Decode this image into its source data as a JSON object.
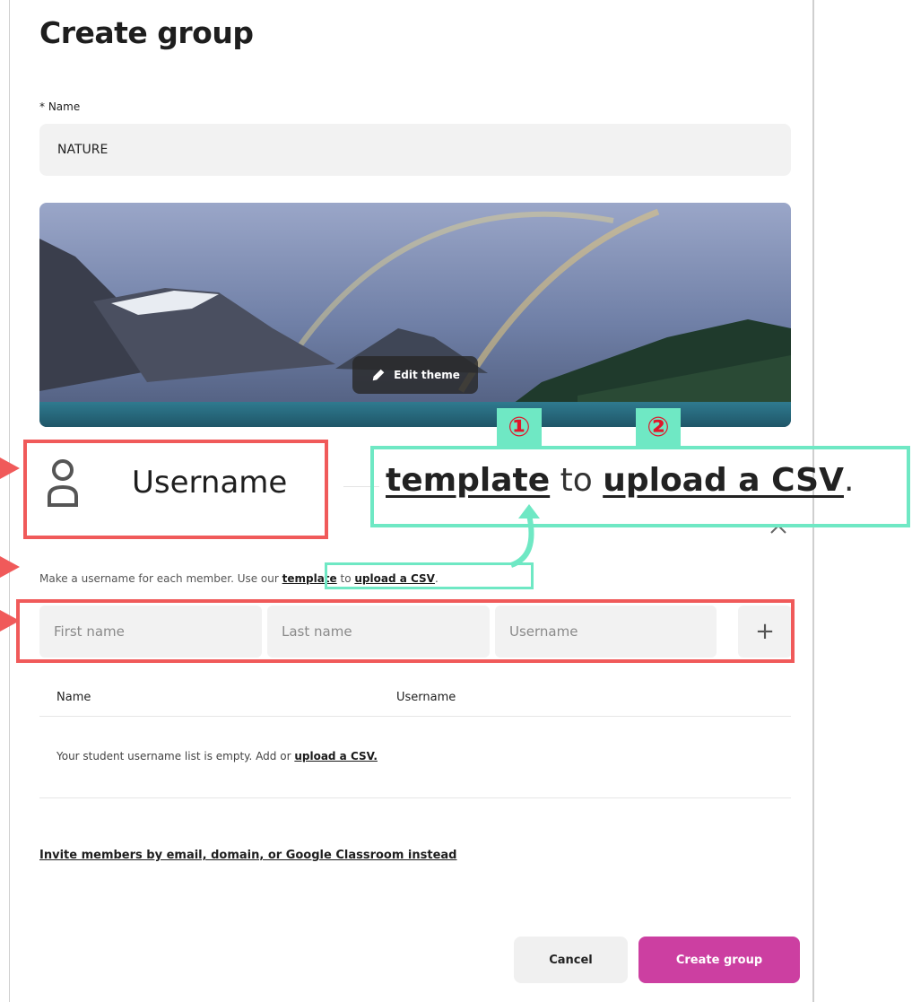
{
  "dialog": {
    "title": "Create group",
    "name_label": "* Name",
    "name_value": "NATURE",
    "edit_theme_label": "Edit theme"
  },
  "username_section": {
    "title": "Username",
    "help_prefix": "Make a username for each member. Use our ",
    "help_template_link": "template",
    "help_middle": " to ",
    "help_csv_link": "upload a CSV",
    "help_suffix": ".",
    "first_name_placeholder": "First name",
    "last_name_placeholder": "Last name",
    "username_placeholder": "Username",
    "add_label": "+"
  },
  "table": {
    "columns": [
      "Name",
      "Username"
    ],
    "empty_prefix": "Your student username list is empty. Add or ",
    "empty_link": "upload a CSV."
  },
  "invite_link": "Invite members by email, domain, or Google Classroom instead",
  "buttons": {
    "cancel": "Cancel",
    "create": "Create group"
  },
  "annotation": {
    "zoom_template": "template",
    "zoom_middle": " to ",
    "zoom_csv": "upload a CSV",
    "zoom_suffix": ".",
    "badge_1": "①",
    "badge_2": "②"
  },
  "colors": {
    "primary": "#cc3fa1",
    "annotation_red": "#f05a5a",
    "annotation_green": "#6fe8c4",
    "badge_text": "#e0152a"
  }
}
